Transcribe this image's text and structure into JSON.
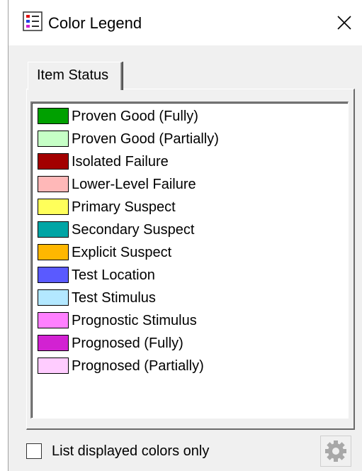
{
  "window": {
    "title": "Color Legend"
  },
  "tabs": [
    {
      "label": "Item Status",
      "selected": true
    }
  ],
  "legend_items": [
    {
      "label": "Proven Good (Fully)",
      "color": "#00a000"
    },
    {
      "label": "Proven Good (Partially)",
      "color": "#c6ffc6"
    },
    {
      "label": "Isolated Failure",
      "color": "#a30000"
    },
    {
      "label": "Lower-Level Failure",
      "color": "#ffb8b8"
    },
    {
      "label": "Primary Suspect",
      "color": "#ffff5a"
    },
    {
      "label": "Secondary Suspect",
      "color": "#00a5a5"
    },
    {
      "label": "Explicit Suspect",
      "color": "#ffb700"
    },
    {
      "label": "Test Location",
      "color": "#5a5aff"
    },
    {
      "label": "Test Stimulus",
      "color": "#b3e8ff"
    },
    {
      "label": "Prognostic Stimulus",
      "color": "#ff80ff"
    },
    {
      "label": "Prognosed (Fully)",
      "color": "#d222d2"
    },
    {
      "label": "Prognosed (Partially)",
      "color": "#ffccff"
    }
  ],
  "filter": {
    "label": "List displayed colors only",
    "checked": false
  },
  "icons": {
    "app": "color-legend-app-icon",
    "close": "close-icon",
    "settings": "gear-icon"
  }
}
